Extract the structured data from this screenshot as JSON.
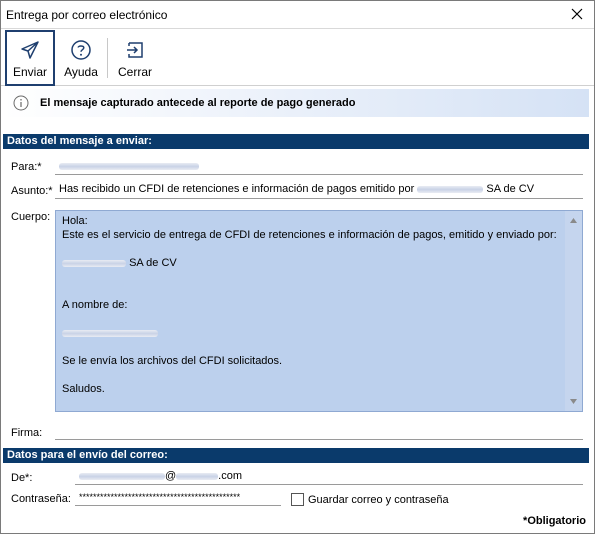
{
  "window": {
    "title": "Entrega por correo electrónico"
  },
  "toolbar": {
    "send_label": "Enviar",
    "help_label": "Ayuda",
    "close_label": "Cerrar"
  },
  "info": {
    "message": "El mensaje capturado antecede al reporte de pago generado"
  },
  "message_section": {
    "title": "Datos del mensaje a enviar:",
    "to_label": "Para:*",
    "subject_label": "Asunto:*",
    "subject_prefix": "Has recibido un CFDI de retenciones e información de pagos emitido por",
    "subject_suffix": "SA de CV",
    "body_label": "Cuerpo:",
    "body_lines": {
      "greeting": "Hola:",
      "intro": "Este es el servicio de entrega de CFDI de retenciones e información de pagos, emitido y enviado por:",
      "company_suffix": "SA de CV",
      "on_behalf": "A nombre de:",
      "files": "Se le envía los archivos del CFDI solicitados.",
      "closing": "Saludos."
    },
    "signature_label": "Firma:",
    "signature_value": ""
  },
  "send_section": {
    "title": "Datos para el envío del correo:",
    "from_label": "De*:",
    "from_at": "@",
    "from_domain_suffix": ".com",
    "password_label": "Contraseña:",
    "password_value": "**********************************************",
    "save_checkbox_label": "Guardar correo y contraseña",
    "save_checked": false
  },
  "footer": {
    "required_note": "*Obligatorio"
  },
  "colors": {
    "section_header": "#0a3a6b",
    "body_background": "#bcd0ed",
    "accent_border": "#1f3f6f"
  },
  "icons": {
    "close": "close-icon",
    "send": "paper-plane-icon",
    "help": "question-circle-icon",
    "exit": "exit-arrow-icon",
    "info": "info-circle-icon"
  }
}
